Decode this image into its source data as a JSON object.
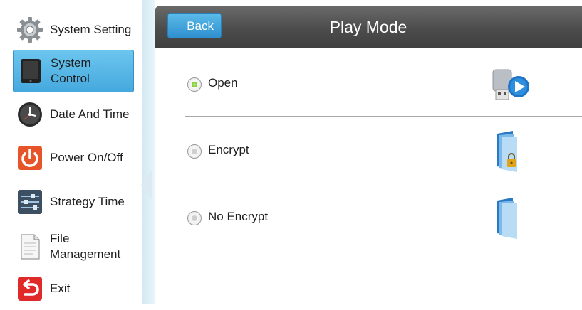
{
  "sidebar": {
    "items": [
      {
        "label": "System Setting",
        "icon": "gear-icon"
      },
      {
        "label": "System Control",
        "icon": "tablet-icon"
      },
      {
        "label": "Date And Time",
        "icon": "clock-icon"
      },
      {
        "label": "Power On/Off",
        "icon": "power-icon"
      },
      {
        "label": "Strategy Time",
        "icon": "sliders-icon"
      },
      {
        "label_line1": "File",
        "label_line2": "Management",
        "icon": "document-icon"
      },
      {
        "label": "Exit",
        "icon": "exit-icon"
      }
    ],
    "active_index": 1
  },
  "header": {
    "back_label": "Back",
    "title": "Play Mode"
  },
  "options": [
    {
      "label": "Open",
      "checked": true,
      "icon": "usb-play-icon"
    },
    {
      "label": "Encrypt",
      "checked": false,
      "icon": "locked-folder-icon"
    },
    {
      "label": "No Encrypt",
      "checked": false,
      "icon": "folder-icon"
    }
  ],
  "colors": {
    "active_item": "#45a9de",
    "header": "#4c4c4c",
    "radio_checked": "#5fb51c"
  }
}
